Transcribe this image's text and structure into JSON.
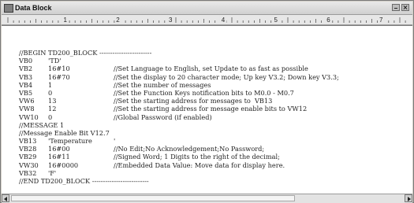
{
  "window": {
    "title": "Data Block"
  },
  "ruler": {
    "labels": [
      "1",
      "2",
      "3",
      "4",
      "5",
      "6",
      "7"
    ]
  },
  "code": {
    "lines": [
      {
        "type": "full",
        "text": "//BEGIN TD200_BLOCK ------------------------"
      },
      {
        "type": "row",
        "addr": "VB0",
        "value": "'TD'",
        "comment": ""
      },
      {
        "type": "row",
        "addr": "VB2",
        "value": "16#10",
        "comment": "//Set Language to English, set Update to as fast as possible"
      },
      {
        "type": "row",
        "addr": "VB3",
        "value": "16#70",
        "comment": "//Set the display to 20 character mode; Up key V3.2; Down key V3.3;"
      },
      {
        "type": "row",
        "addr": "VB4",
        "value": "1",
        "comment": "//Set the number of messages"
      },
      {
        "type": "row",
        "addr": "VB5",
        "value": "0",
        "comment": "//Set the Function Keys notification bits to M0.0 - M0.7"
      },
      {
        "type": "row",
        "addr": "VW6",
        "value": "13",
        "comment": "//Set the starting address for messages to  VB13"
      },
      {
        "type": "row",
        "addr": "VW8",
        "value": "12",
        "comment": "//Set the starting address for message enable bits to VW12"
      },
      {
        "type": "row",
        "addr": "VW10",
        "value": "0",
        "comment": "//Global Password (if enabled)"
      },
      {
        "type": "full",
        "text": "//MESSAGE 1"
      },
      {
        "type": "full",
        "text": "//Message Enable Bit V12.7"
      },
      {
        "type": "row",
        "addr": "VB13",
        "value": "'Temperature",
        "comment": "'"
      },
      {
        "type": "row",
        "addr": "VB28",
        "value": "16#00",
        "comment": "//No Edit;No Acknowledgement;No Password;"
      },
      {
        "type": "row",
        "addr": "VB29",
        "value": "16#11",
        "comment": "//Signed Word; 1 Digits to the right of the decimal;"
      },
      {
        "type": "row",
        "addr": "VW30",
        "value": "16#0000",
        "comment": "//Embedded Data Value: Move data for display here."
      },
      {
        "type": "row",
        "addr": "VB32",
        "value": "'F'",
        "comment": ""
      },
      {
        "type": "full",
        "text": "//END TD200_BLOCK --------------------------"
      }
    ]
  }
}
